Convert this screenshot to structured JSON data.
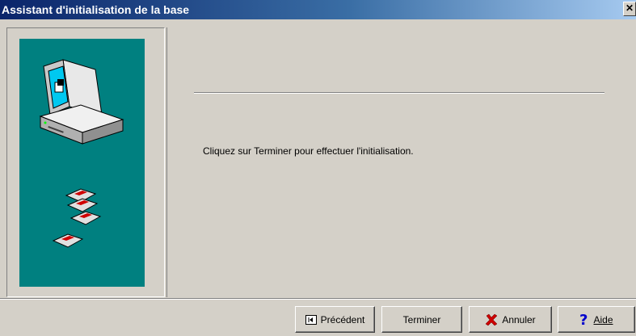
{
  "window": {
    "title": "Assistant d'initialisation de la base",
    "close_label": "✕"
  },
  "main": {
    "message": "Cliquez sur Terminer pour effectuer l'initialisation."
  },
  "buttons": {
    "previous": "Précédent",
    "finish": "Terminer",
    "cancel": "Annuler",
    "help": "Aide"
  },
  "colors": {
    "title_start": "#0a246a",
    "panel_bg": "#008080",
    "face": "#d4d0c8",
    "cancel_icon": "#cc0000",
    "help_icon": "#0000cc"
  },
  "icons": [
    "computer-icon",
    "floppy-disk-icon",
    "previous-icon",
    "cancel-x-icon",
    "help-question-icon"
  ]
}
